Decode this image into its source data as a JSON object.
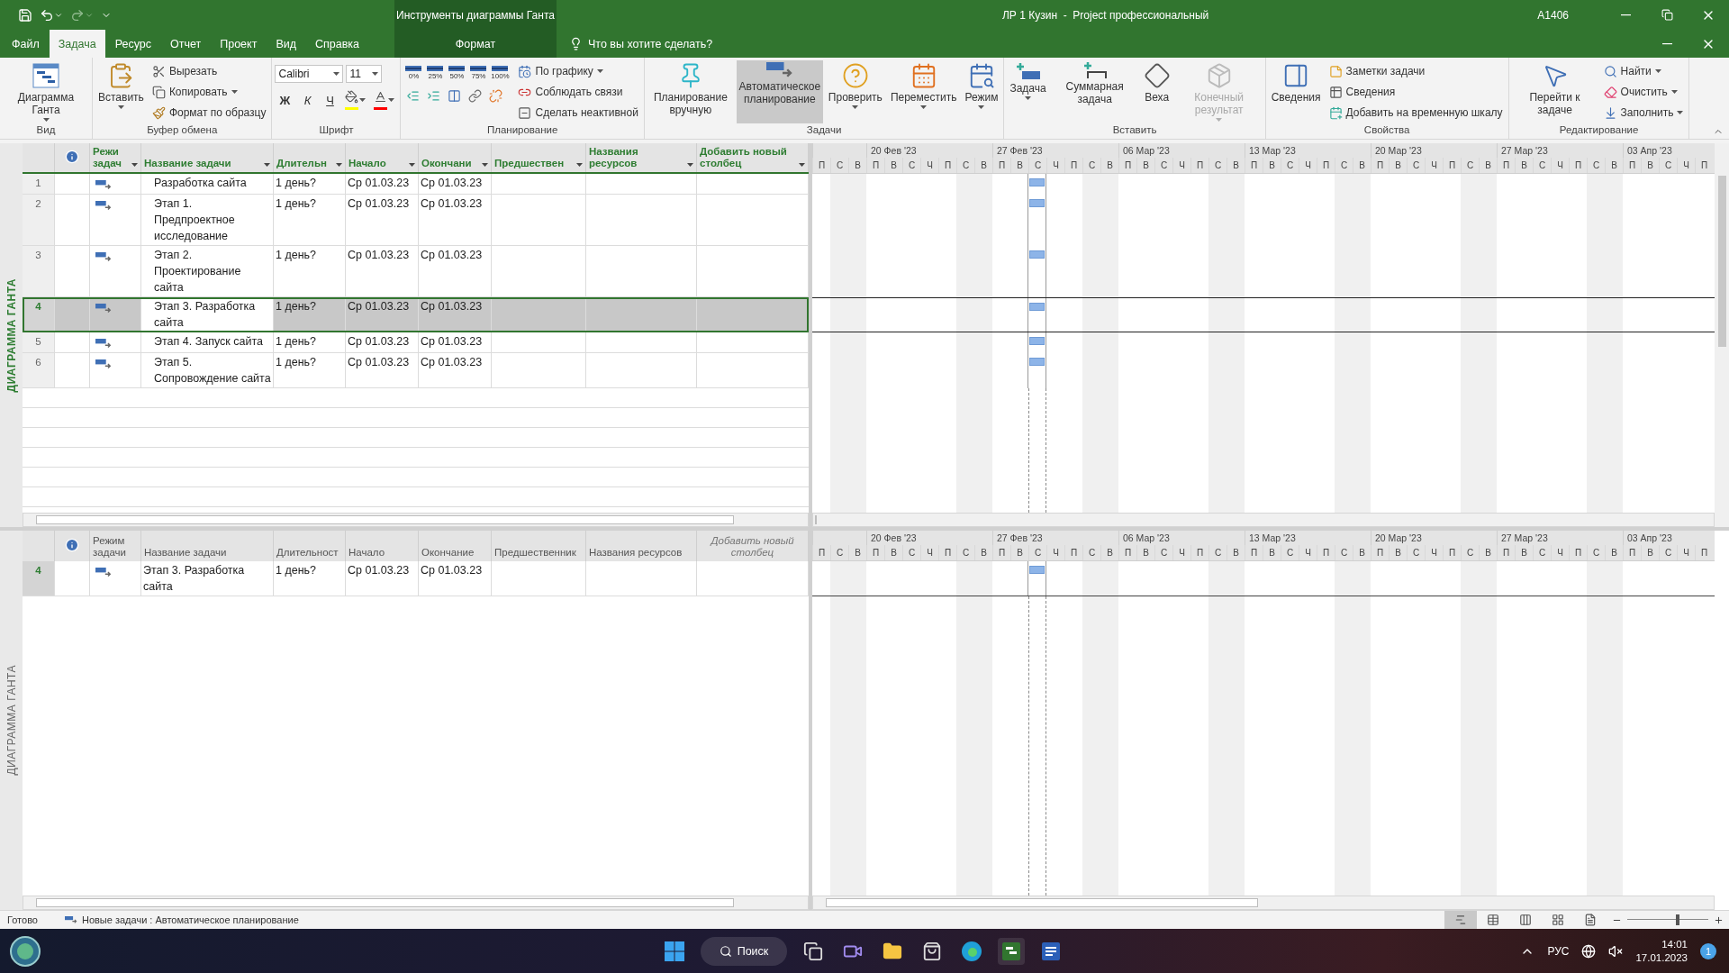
{
  "title_bar": {
    "context_title": "Инструменты диаграммы Ганта",
    "title": "ЛР 1 Кузин  -  Project профессиональный",
    "user": "A1406"
  },
  "tabs": [
    {
      "label": "Файл",
      "selected": false,
      "kind": "file"
    },
    {
      "label": "Задача",
      "selected": true,
      "kind": "normal"
    },
    {
      "label": "Ресурс",
      "selected": false,
      "kind": "normal"
    },
    {
      "label": "Отчет",
      "selected": false,
      "kind": "normal"
    },
    {
      "label": "Проект",
      "selected": false,
      "kind": "normal"
    },
    {
      "label": "Вид",
      "selected": false,
      "kind": "normal"
    },
    {
      "label": "Справка",
      "selected": false,
      "kind": "normal"
    },
    {
      "label": "Формат",
      "selected": false,
      "kind": "contextual"
    }
  ],
  "tell_me": "Что вы хотите сделать?",
  "ribbon": {
    "groups": [
      {
        "label": "Вид",
        "kind": "stack",
        "items": [
          {
            "kind": "large",
            "label": "Диаграмма Ганта",
            "dropdown": true
          }
        ]
      },
      {
        "label": "Буфер обмена",
        "kind": "stack",
        "items": [
          {
            "kind": "large",
            "label": "Вставить",
            "dropdown": true
          },
          {
            "kind": "small",
            "label": "Вырезать",
            "dropdown": false
          },
          {
            "kind": "small",
            "label": "Копировать",
            "dropdown": true
          },
          {
            "kind": "small",
            "label": "Формат по образцу",
            "dropdown": false
          }
        ]
      },
      {
        "label": "Шрифт",
        "kind": "font",
        "items": [
          {
            "kind": "combo",
            "value": "Calibri"
          },
          {
            "kind": "combo",
            "value": "11"
          },
          {
            "kind": "glyph",
            "label": "Ж"
          },
          {
            "kind": "glyph",
            "label": "К"
          },
          {
            "kind": "glyph",
            "label": "Ч"
          },
          {
            "kind": "color",
            "color": "#ffff00"
          },
          {
            "kind": "color",
            "color": "#ff0000"
          }
        ]
      },
      {
        "label": "Планирование",
        "kind": "planning",
        "items": [
          {
            "kind": "percent",
            "label": "0%"
          },
          {
            "kind": "percent",
            "label": "25%"
          },
          {
            "kind": "percent",
            "label": "50%"
          },
          {
            "kind": "percent",
            "label": "75%"
          },
          {
            "kind": "percent",
            "label": "100%"
          },
          {
            "kind": "icon"
          },
          {
            "kind": "icon"
          },
          {
            "kind": "icon"
          },
          {
            "kind": "icon"
          },
          {
            "kind": "icon"
          },
          {
            "kind": "small",
            "label": "По графику",
            "dropdown": true
          },
          {
            "kind": "small",
            "label": "Соблюдать связи",
            "dropdown": false
          },
          {
            "kind": "small",
            "label": "Сделать неактивной",
            "dropdown": false
          }
        ]
      },
      {
        "label": "Задачи",
        "kind": "stack",
        "items": [
          {
            "kind": "large",
            "label": "Планирование вручную",
            "dropdown": false,
            "selected": false
          },
          {
            "kind": "large",
            "label": "Автоматическое планирование",
            "dropdown": false,
            "selected": true
          },
          {
            "kind": "large",
            "label": "Проверить",
            "dropdown": true,
            "selected": false
          },
          {
            "kind": "large",
            "label": "Переместить",
            "dropdown": true,
            "selected": false
          },
          {
            "kind": "large",
            "label": "Режим",
            "dropdown": true,
            "selected": false
          }
        ]
      },
      {
        "label": "Вставить",
        "kind": "stack",
        "items": [
          {
            "kind": "large",
            "label": "Задача",
            "dropdown": true,
            "disabled": false
          },
          {
            "kind": "large",
            "label": "Суммарная задача",
            "dropdown": false,
            "disabled": false
          },
          {
            "kind": "large",
            "label": "Веха",
            "dropdown": false,
            "disabled": false
          },
          {
            "kind": "large",
            "label": "Конечный результат",
            "dropdown": true,
            "disabled": true
          }
        ]
      },
      {
        "label": "Свойства",
        "kind": "stack",
        "items": [
          {
            "kind": "large",
            "label": "Сведения",
            "dropdown": false
          },
          {
            "kind": "small",
            "label": "Заметки задачи",
            "dropdown": false
          },
          {
            "kind": "small",
            "label": "Сведения",
            "dropdown": false
          },
          {
            "kind": "small",
            "label": "Добавить на временную шкалу",
            "dropdown": false
          }
        ]
      },
      {
        "label": "Редактирование",
        "kind": "stack",
        "items": [
          {
            "kind": "large",
            "label": "Перейти к задаче",
            "dropdown": false
          },
          {
            "kind": "small",
            "label": "Найти",
            "dropdown": true
          },
          {
            "kind": "small",
            "label": "Очистить",
            "dropdown": true
          },
          {
            "kind": "small",
            "label": "Заполнить",
            "dropdown": true
          }
        ]
      }
    ]
  },
  "panes": [
    {
      "kind": "sheet",
      "view_label": "ДИАГРАММА ГАНТА",
      "columns": [
        {
          "kind": "info"
        },
        {
          "label": "Режи задач",
          "filter": true
        },
        {
          "label": "Название задачи",
          "filter": true
        },
        {
          "label": "Длительн",
          "filter": true
        },
        {
          "label": "Начало",
          "filter": true
        },
        {
          "label": "Окончани",
          "filter": true
        },
        {
          "label": "Предшествен",
          "filter": true
        },
        {
          "label": "Названия ресурсов",
          "filter": true
        },
        {
          "label": "Добавить новый столбец",
          "filter": true
        }
      ],
      "rows": [
        {
          "id": "1",
          "name": "Разработка сайта",
          "duration": "1 день?",
          "start": "Ср 01.03.23",
          "finish": "Ср 01.03.23",
          "selected": false
        },
        {
          "id": "2",
          "name": "Этап 1. Предпроектное исследование",
          "duration": "1 день?",
          "start": "Ср 01.03.23",
          "finish": "Ср 01.03.23",
          "selected": false
        },
        {
          "id": "3",
          "name": "Этап 2. Проектирование сайта",
          "duration": "1 день?",
          "start": "Ср 01.03.23",
          "finish": "Ср 01.03.23",
          "selected": false
        },
        {
          "id": "4",
          "name": "Этап 3. Разработка сайта",
          "duration": "1 день?",
          "start": "Ср 01.03.23",
          "finish": "Ср 01.03.23",
          "selected": true
        },
        {
          "id": "5",
          "name": "Этап 4. Запуск сайта",
          "duration": "1 день?",
          "start": "Ср 01.03.23",
          "finish": "Ср 01.03.23",
          "selected": false
        },
        {
          "id": "6",
          "name": "Этап 5. Сопровождение сайта",
          "duration": "1 день?",
          "start": "Ср 01.03.23",
          "finish": "Ср 01.03.23",
          "selected": false
        }
      ],
      "timescale": [
        {
          "days": [
            {
              "label": "П",
              "weekend": false
            },
            {
              "label": "С",
              "weekend": true
            },
            {
              "label": "В",
              "weekend": true
            }
          ]
        },
        {
          "label": "20 Фев '23",
          "days": [
            {
              "label": "П",
              "weekend": false
            },
            {
              "label": "В",
              "weekend": false
            },
            {
              "label": "С",
              "weekend": false
            },
            {
              "label": "Ч",
              "weekend": false
            },
            {
              "label": "П",
              "weekend": false
            },
            {
              "label": "С",
              "weekend": true
            },
            {
              "label": "В",
              "weekend": true
            }
          ]
        },
        {
          "label": "27 Фев '23",
          "days": [
            {
              "label": "П",
              "weekend": false
            },
            {
              "label": "В",
              "weekend": false
            },
            {
              "label": "С",
              "weekend": false,
              "marked": true
            },
            {
              "label": "Ч",
              "weekend": false
            },
            {
              "label": "П",
              "weekend": false
            },
            {
              "label": "С",
              "weekend": true
            },
            {
              "label": "В",
              "weekend": true
            }
          ]
        },
        {
          "label": "06 Мар '23",
          "days": [
            {
              "label": "П",
              "weekend": false
            },
            {
              "label": "В",
              "weekend": false
            },
            {
              "label": "С",
              "weekend": false
            },
            {
              "label": "Ч",
              "weekend": false
            },
            {
              "label": "П",
              "weekend": false
            },
            {
              "label": "С",
              "weekend": true
            },
            {
              "label": "В",
              "weekend": true
            }
          ]
        },
        {
          "label": "13 Мар '23",
          "days": [
            {
              "label": "П",
              "weekend": false
            },
            {
              "label": "В",
              "weekend": false
            },
            {
              "label": "С",
              "weekend": false
            },
            {
              "label": "Ч",
              "weekend": false
            },
            {
              "label": "П",
              "weekend": false
            },
            {
              "label": "С",
              "weekend": true
            },
            {
              "label": "В",
              "weekend": true
            }
          ]
        },
        {
          "label": "20 Мар '23",
          "days": [
            {
              "label": "П",
              "weekend": false
            },
            {
              "label": "В",
              "weekend": false
            },
            {
              "label": "С",
              "weekend": false
            },
            {
              "label": "Ч",
              "weekend": false
            },
            {
              "label": "П",
              "weekend": false
            },
            {
              "label": "С",
              "weekend": true
            },
            {
              "label": "В",
              "weekend": true
            }
          ]
        },
        {
          "label": "27 Мар '23",
          "days": [
            {
              "label": "П",
              "weekend": false
            },
            {
              "label": "В",
              "weekend": false
            },
            {
              "label": "С",
              "weekend": false
            },
            {
              "label": "Ч",
              "weekend": false
            },
            {
              "label": "П",
              "weekend": false
            },
            {
              "label": "С",
              "weekend": true
            },
            {
              "label": "В",
              "weekend": true
            }
          ]
        },
        {
          "label": "03 Апр '23",
          "days": [
            {
              "label": "П",
              "weekend": false
            },
            {
              "label": "В",
              "weekend": false
            },
            {
              "label": "С",
              "weekend": false
            },
            {
              "label": "Ч",
              "weekend": false
            },
            {
              "label": "П",
              "weekend": false
            }
          ]
        }
      ]
    },
    {
      "kind": "detail",
      "view_label": "ДИАГРАММА ГАНТА",
      "columns": [
        {
          "kind": "info"
        },
        {
          "label": "Режим задачи",
          "filter": false
        },
        {
          "label": "Название задачи",
          "filter": false
        },
        {
          "label": "Длительност",
          "filter": false
        },
        {
          "label": "Начало",
          "filter": false
        },
        {
          "label": "Окончание",
          "filter": false
        },
        {
          "label": "Предшественник",
          "filter": false
        },
        {
          "label": "Названия ресурсов",
          "filter": false
        },
        {
          "label": "Добавить новый столбец",
          "filter": false,
          "kind": "placeholder"
        }
      ],
      "rows": [
        {
          "id": "4",
          "name": "Этап 3. Разработка сайта",
          "duration": "1 день?",
          "start": "Ср 01.03.23",
          "finish": "Ср 01.03.23",
          "selected": true
        }
      ],
      "timescale": [
        {
          "days": [
            {
              "label": "П",
              "weekend": false
            },
            {
              "label": "С",
              "weekend": true
            },
            {
              "label": "В",
              "weekend": true
            }
          ]
        },
        {
          "label": "20 Фев '23",
          "days": [
            {
              "label": "П",
              "weekend": false
            },
            {
              "label": "В",
              "weekend": false
            },
            {
              "label": "С",
              "weekend": false
            },
            {
              "label": "Ч",
              "weekend": false
            },
            {
              "label": "П",
              "weekend": false
            },
            {
              "label": "С",
              "weekend": true
            },
            {
              "label": "В",
              "weekend": true
            }
          ]
        },
        {
          "label": "27 Фев '23",
          "days": [
            {
              "label": "П",
              "weekend": false
            },
            {
              "label": "В",
              "weekend": false
            },
            {
              "label": "С",
              "weekend": false,
              "marked": true
            },
            {
              "label": "Ч",
              "weekend": false
            },
            {
              "label": "П",
              "weekend": false
            },
            {
              "label": "С",
              "weekend": true
            },
            {
              "label": "В",
              "weekend": true
            }
          ]
        },
        {
          "label": "06 Мар '23",
          "days": [
            {
              "label": "П",
              "weekend": false
            },
            {
              "label": "В",
              "weekend": false
            },
            {
              "label": "С",
              "weekend": false
            },
            {
              "label": "Ч",
              "weekend": false
            },
            {
              "label": "П",
              "weekend": false
            },
            {
              "label": "С",
              "weekend": true
            },
            {
              "label": "В",
              "weekend": true
            }
          ]
        },
        {
          "label": "13 Мар '23",
          "days": [
            {
              "label": "П",
              "weekend": false
            },
            {
              "label": "В",
              "weekend": false
            },
            {
              "label": "С",
              "weekend": false
            },
            {
              "label": "Ч",
              "weekend": false
            },
            {
              "label": "П",
              "weekend": false
            },
            {
              "label": "С",
              "weekend": true
            },
            {
              "label": "В",
              "weekend": true
            }
          ]
        },
        {
          "label": "20 Мар '23",
          "days": [
            {
              "label": "П",
              "weekend": false
            },
            {
              "label": "В",
              "weekend": false
            },
            {
              "label": "С",
              "weekend": false
            },
            {
              "label": "Ч",
              "weekend": false
            },
            {
              "label": "П",
              "weekend": false
            },
            {
              "label": "С",
              "weekend": true
            },
            {
              "label": "В",
              "weekend": true
            }
          ]
        },
        {
          "label": "27 Мар '23",
          "days": [
            {
              "label": "П",
              "weekend": false
            },
            {
              "label": "В",
              "weekend": false
            },
            {
              "label": "С",
              "weekend": false
            },
            {
              "label": "Ч",
              "weekend": false
            },
            {
              "label": "П",
              "weekend": false
            },
            {
              "label": "С",
              "weekend": true
            },
            {
              "label": "В",
              "weekend": true
            }
          ]
        },
        {
          "label": "03 Апр '23",
          "days": [
            {
              "label": "П",
              "weekend": false
            },
            {
              "label": "В",
              "weekend": false
            },
            {
              "label": "С",
              "weekend": false
            },
            {
              "label": "Ч",
              "weekend": false
            },
            {
              "label": "П",
              "weekend": false
            }
          ]
        }
      ]
    }
  ],
  "status_bar": {
    "status": "Готово",
    "mode": "Новые задачи : Автоматическое планирование",
    "zoom": {
      "level": 0.62
    }
  },
  "taskbar": {
    "search": "Поиск",
    "language": "РУС",
    "time": "14:01",
    "date": "17.01.2023",
    "notifications": "1"
  }
}
